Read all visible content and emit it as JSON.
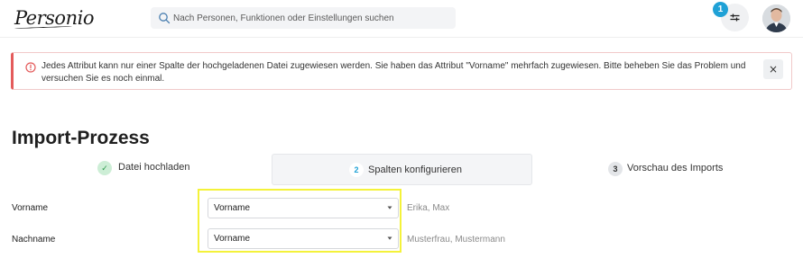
{
  "header": {
    "logo_text": "Personio",
    "search_placeholder": "Nach Personen, Funktionen oder Einstellungen suchen",
    "filter_badge_count": "1",
    "accent_color": "#1fa1d6"
  },
  "alert": {
    "message": "Jedes Attribut kann nur einer Spalte der hochgeladenen Datei zugewiesen werden. Sie haben das Attribut \"Vorname\" mehrfach zugewiesen. Bitte beheben Sie das Problem und versuchen Sie es noch einmal.",
    "close_label": "×",
    "icon": "error-circle-icon",
    "border_color": "#e45b5b"
  },
  "page": {
    "title": "Import-Prozess"
  },
  "steps": [
    {
      "marker": "✓",
      "label": "Datei hochladen",
      "state": "done"
    },
    {
      "marker": "2",
      "label": "Spalten konfigurieren",
      "state": "active"
    },
    {
      "marker": "3",
      "label": "Vorschau des Imports",
      "state": "upcoming"
    }
  ],
  "mapping_rows": [
    {
      "label": "Vorname",
      "selected": "Vorname",
      "sample": "Erika, Max"
    },
    {
      "label": "Nachname",
      "selected": "Vorname",
      "sample": "Musterfrau, Mustermann"
    }
  ]
}
